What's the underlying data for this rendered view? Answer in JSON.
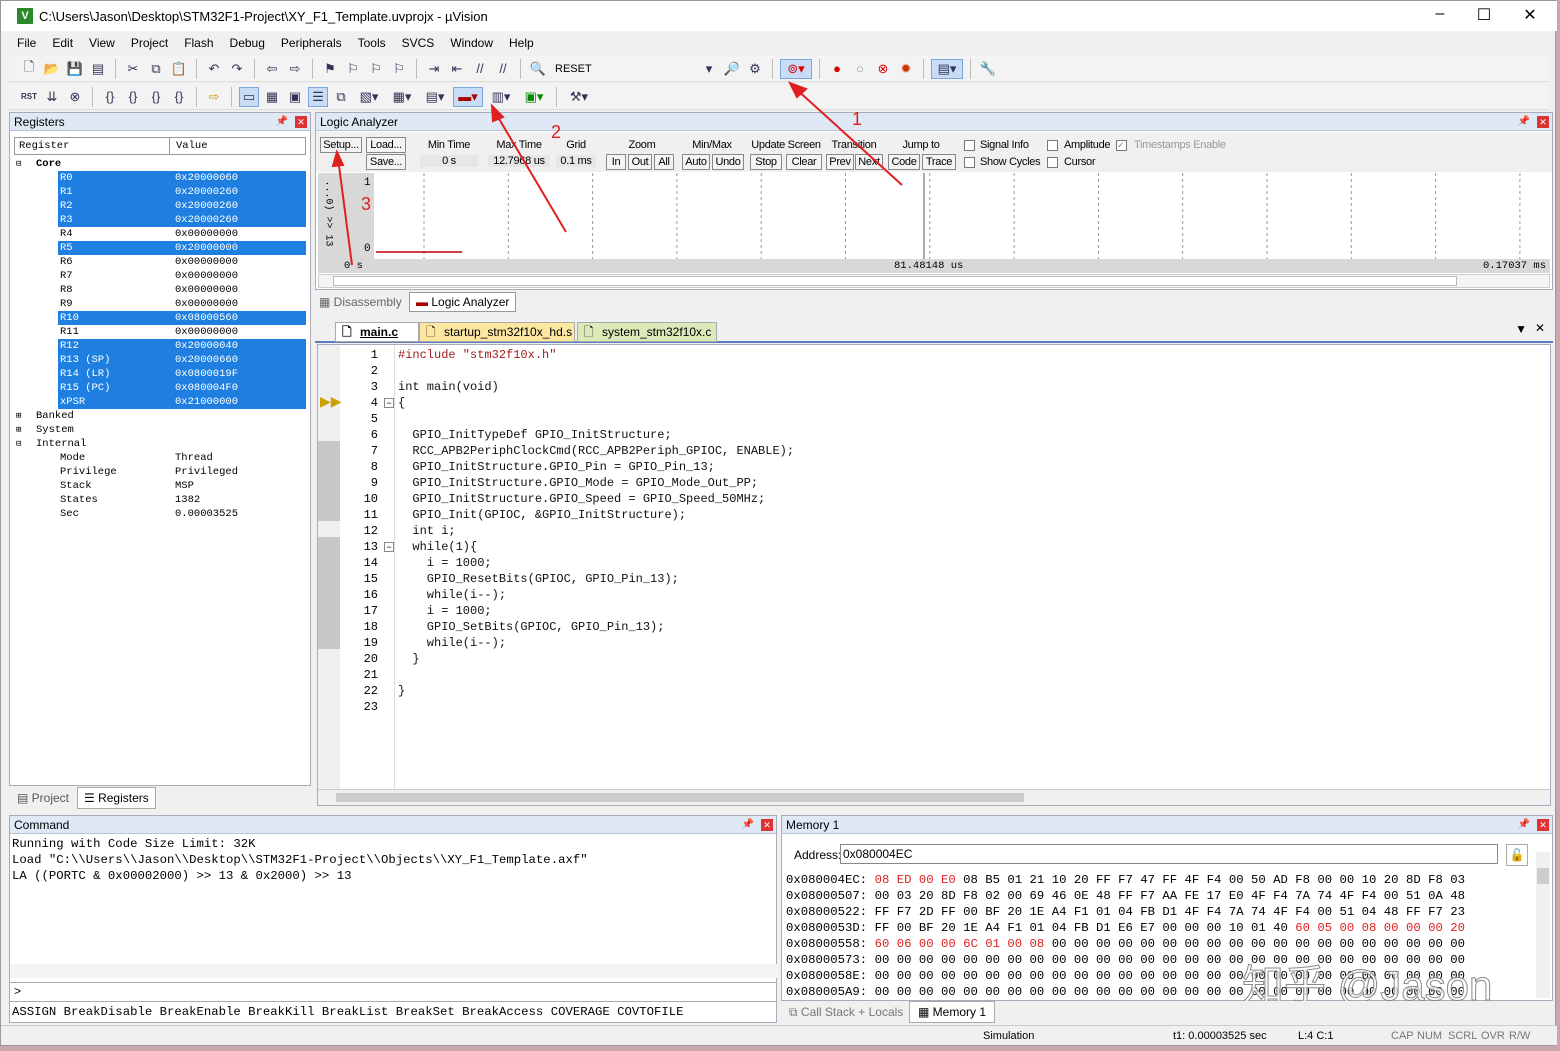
{
  "window": {
    "title": "C:\\Users\\Jason\\Desktop\\STM32F1-Project\\XY_F1_Template.uvprojx - µVision",
    "logo": "V"
  },
  "menu": [
    "File",
    "Edit",
    "View",
    "Project",
    "Flash",
    "Debug",
    "Peripherals",
    "Tools",
    "SVCS",
    "Window",
    "Help"
  ],
  "toolbar": {
    "reset_label": "RESET",
    "rst_label": "RST"
  },
  "registers": {
    "title": "Registers",
    "col_register": "Register",
    "col_value": "Value",
    "groups": {
      "core": "Core",
      "banked": "Banked",
      "system": "System",
      "internal": "Internal"
    },
    "core": [
      [
        "R0",
        "0x20000060",
        true
      ],
      [
        "R1",
        "0x20000260",
        true
      ],
      [
        "R2",
        "0x20000260",
        true
      ],
      [
        "R3",
        "0x20000260",
        true
      ],
      [
        "R4",
        "0x00000000",
        false
      ],
      [
        "R5",
        "0x20000000",
        true
      ],
      [
        "R6",
        "0x00000000",
        false
      ],
      [
        "R7",
        "0x00000000",
        false
      ],
      [
        "R8",
        "0x00000000",
        false
      ],
      [
        "R9",
        "0x00000000",
        false
      ],
      [
        "R10",
        "0x08000560",
        true
      ],
      [
        "R11",
        "0x00000000",
        false
      ],
      [
        "R12",
        "0x20000040",
        true
      ],
      [
        "R13 (SP)",
        "0x20000660",
        true
      ],
      [
        "R14 (LR)",
        "0x0800019F",
        true
      ],
      [
        "R15 (PC)",
        "0x080004F0",
        true
      ],
      [
        "xPSR",
        "0x21000000",
        true
      ]
    ],
    "internal": [
      [
        "Mode",
        "Thread"
      ],
      [
        "Privilege",
        "Privileged"
      ],
      [
        "Stack",
        "MSP"
      ],
      [
        "States",
        "1382"
      ],
      [
        "Sec",
        "0.00003525"
      ]
    ],
    "tabs": [
      "Project",
      "Registers"
    ]
  },
  "logic_analyzer": {
    "title": "Logic Analyzer",
    "setup": "Setup...",
    "load": "Load...",
    "save": "Save...",
    "min_time_label": "Min Time",
    "min_time": "0 s",
    "max_time_label": "Max Time",
    "max_time": "12.7968 us",
    "grid_label": "Grid",
    "grid": "0.1 ms",
    "zoom_label": "Zoom",
    "zoom_in": "In",
    "zoom_out": "Out",
    "zoom_all": "All",
    "minmax_label": "Min/Max",
    "auto": "Auto",
    "undo": "Undo",
    "update_label": "Update Screen",
    "stop": "Stop",
    "clear": "Clear",
    "transition_label": "Transition",
    "prev": "Prev",
    "next": "Next",
    "jump_label": "Jump to",
    "code": "Code",
    "trace": "Trace",
    "signal_info": "Signal Info",
    "amplitude": "Amplitude",
    "timestamps": "Timestamps Enable",
    "show_cycles": "Show Cycles",
    "cursor": "Cursor",
    "signal_name": "...0) >> 13",
    "y_high": "1",
    "y_low": "0",
    "t_start": "0 s",
    "t_mid": "81.48148 us",
    "t_end": "0.17037 ms",
    "bottom_tabs": [
      "Disassembly",
      "Logic Analyzer"
    ]
  },
  "editor": {
    "tabs": [
      "main.c",
      "startup_stm32f10x_hd.s",
      "system_stm32f10x.c"
    ],
    "lines": [
      "#include \"stm32f10x.h\"",
      "",
      "int main(void)",
      "{",
      "",
      "  GPIO_InitTypeDef GPIO_InitStructure;",
      "  RCC_APB2PeriphClockCmd(RCC_APB2Periph_GPIOC, ENABLE);",
      "  GPIO_InitStructure.GPIO_Pin = GPIO_Pin_13;",
      "  GPIO_InitStructure.GPIO_Mode = GPIO_Mode_Out_PP;",
      "  GPIO_InitStructure.GPIO_Speed = GPIO_Speed_50MHz;",
      "  GPIO_Init(GPIOC, &GPIO_InitStructure);",
      "  int i;",
      "  while(1){",
      "    i = 1000;",
      "    GPIO_ResetBits(GPIOC, GPIO_Pin_13);",
      "    while(i--);",
      "    i = 1000;",
      "    GPIO_SetBits(GPIOC, GPIO_Pin_13);",
      "    while(i--);",
      "  }",
      "",
      "}",
      ""
    ]
  },
  "command": {
    "title": "Command",
    "output": [
      "Running with Code Size Limit: 32K",
      "Load \"C:\\\\Users\\\\Jason\\\\Desktop\\\\STM32F1-Project\\\\Objects\\\\XY_F1_Template.axf\"",
      "LA ((PORTC & 0x00002000) >> 13 & 0x2000) >> 13"
    ],
    "prompt": ">",
    "hints": "ASSIGN BreakDisable BreakEnable BreakKill BreakList BreakSet BreakAccess COVERAGE COVTOFILE"
  },
  "memory": {
    "title": "Memory 1",
    "address_label": "Address:",
    "address": "0x080004EC",
    "rows": [
      [
        "0x080004EC:",
        "08 ED 00 E0 08 B5 01 21 10 20 FF F7 47 FF 4F F4 00 50 AD F8 00 00 10 20 8D F8 03",
        [
          0,
          1,
          2,
          3
        ]
      ],
      [
        "0x08000507:",
        "00 03 20 8D F8 02 00 69 46 0E 48 FF F7 AA FE 17 E0 4F F4 7A 74 4F F4 00 51 0A 48",
        []
      ],
      [
        "0x08000522:",
        "FF F7 2D FF 00 BF 20 1E A4 F1 01 04 FB D1 4F F4 7A 74 4F F4 00 51 04 48 FF F7 23",
        []
      ],
      [
        "0x0800053D:",
        "FF 00 BF 20 1E A4 F1 01 04 FB D1 E6 E7 00 00 00 10 01 40 60 05 00 08 00 00 00 20",
        [
          19,
          20,
          21,
          22,
          23,
          24,
          25,
          26
        ]
      ],
      [
        "0x08000558:",
        "60 06 00 00 6C 01 00 08 00 00 00 00 00 00 00 00 00 00 00 00 00 00 00 00 00 00 00",
        [
          0,
          1,
          2,
          3,
          4,
          5,
          6,
          7
        ]
      ],
      [
        "0x08000573:",
        "00 00 00 00 00 00 00 00 00 00 00 00 00 00 00 00 00 00 00 00 00 00 00 00 00 00 00",
        []
      ],
      [
        "0x0800058E:",
        "00 00 00 00 00 00 00 00 00 00 00 00 00 00 00 00 00 00 00 00 00 00 00 00 00 00 00",
        []
      ],
      [
        "0x080005A9:",
        "00 00 00 00 00 00 00 00 00 00 00 00 00 00 00 00 00 00 00 00 00 00 00 00 00 00 00",
        []
      ]
    ],
    "tabs": [
      "Call Stack + Locals",
      "Memory 1"
    ]
  },
  "status": {
    "mode": "Simulation",
    "time": "t1: 0.00003525 sec",
    "pos": "L:4 C:1",
    "caps": "CAP",
    "num": "NUM",
    "scrl": "SCRL",
    "ovr": "OVR",
    "rw": "R/W"
  },
  "annotations": [
    "1",
    "2",
    "3"
  ],
  "watermark": "知乎 @Jason",
  "colors": {
    "selection": "#1e7fe0",
    "annotation": "#e02020",
    "signal": "#c00000"
  }
}
